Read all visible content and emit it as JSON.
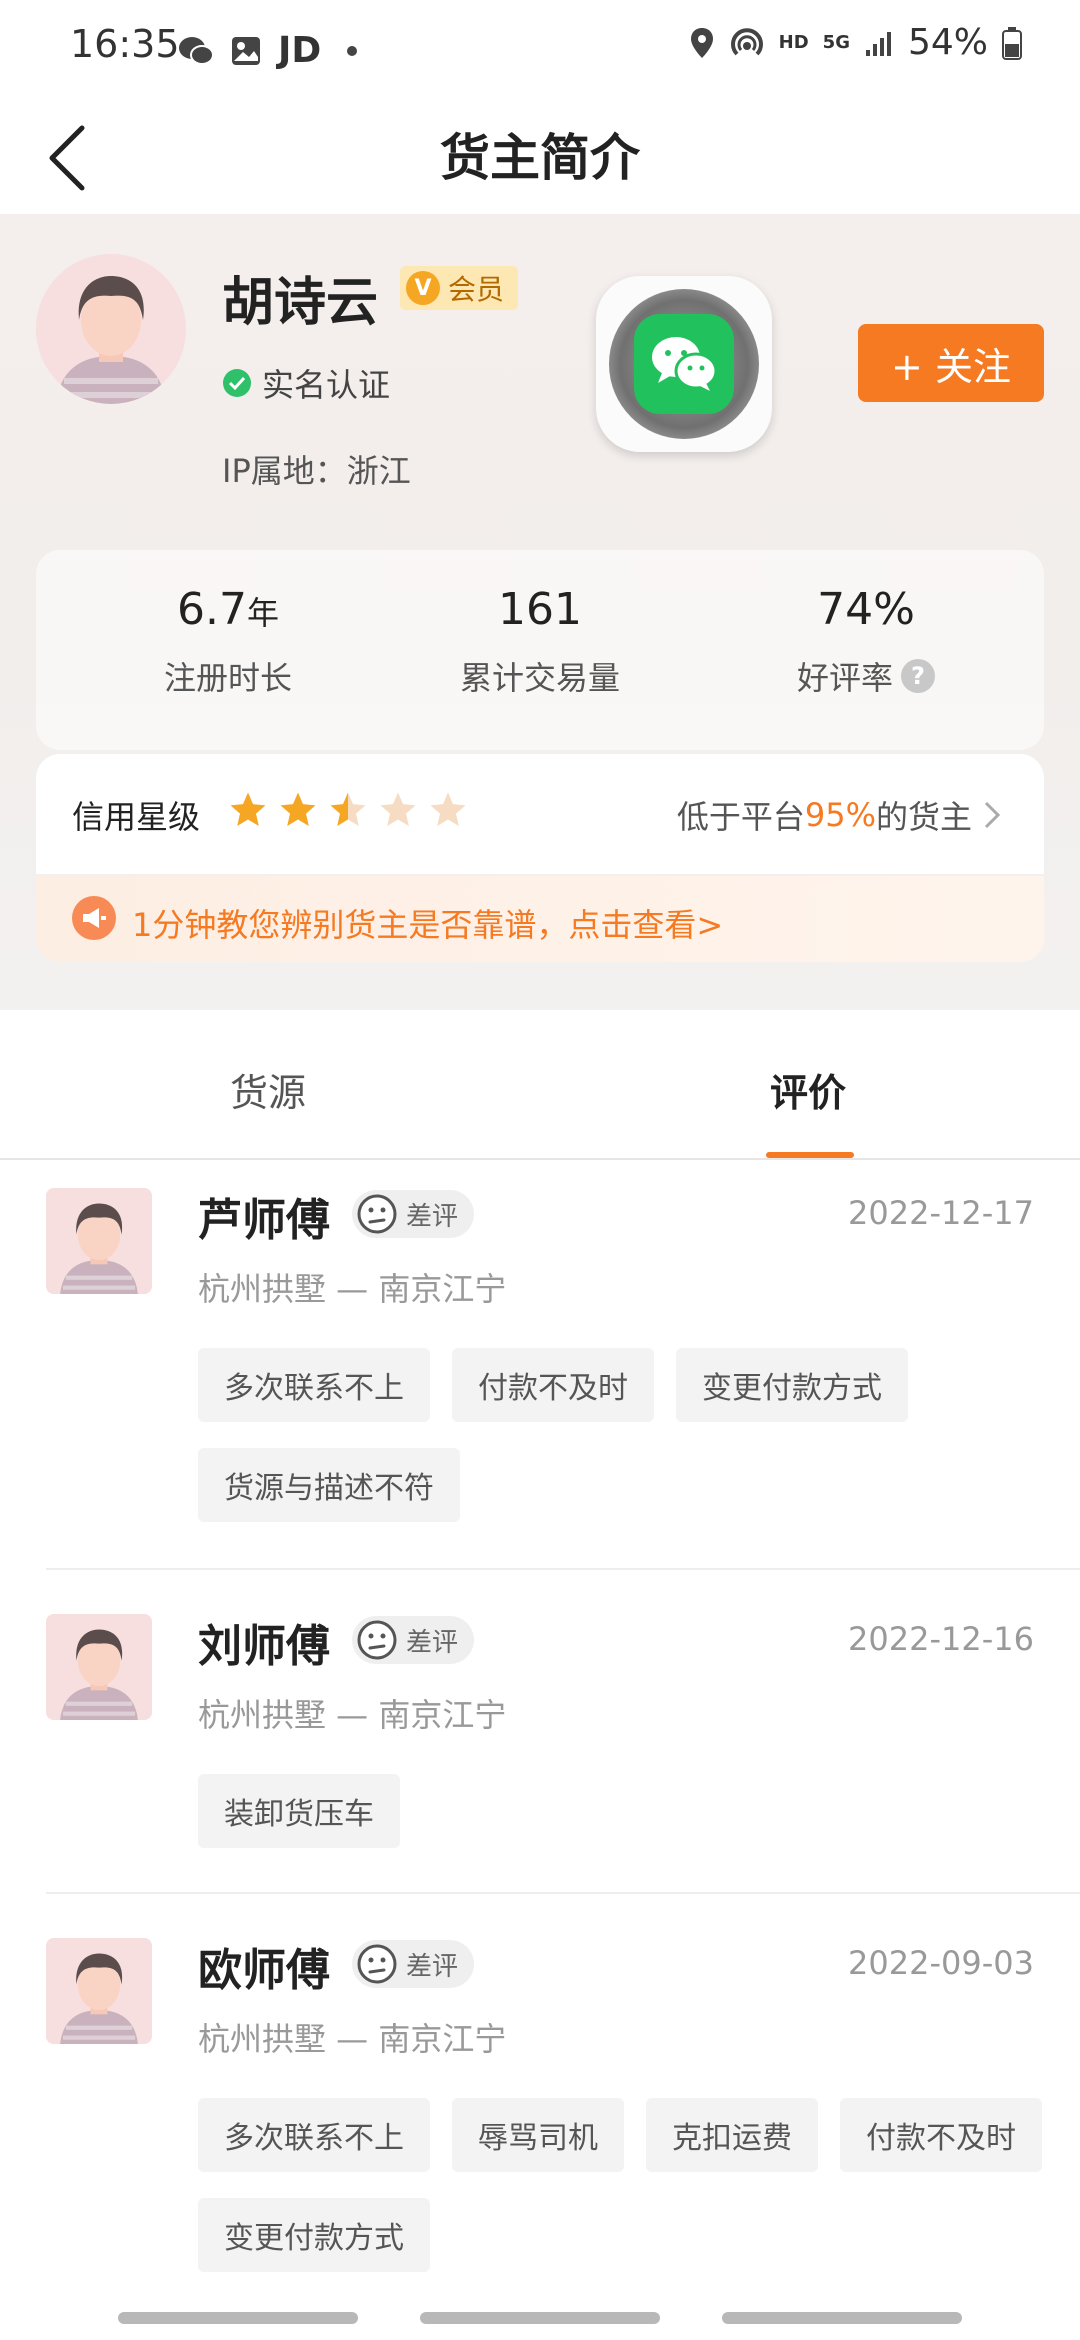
{
  "status_bar": {
    "time": "16:35",
    "app_label": "JD",
    "battery": "54%",
    "network": "5G",
    "hd": "HD"
  },
  "header": {
    "title": "货主简介"
  },
  "profile": {
    "name": "胡诗云",
    "vip_label": "会员",
    "vip_badge_letter": "V",
    "verified_label": "实名认证",
    "ip_label": "IP属地：浙江",
    "follow_label": "+ 关注"
  },
  "stats": [
    {
      "value": "6.7",
      "unit": "年",
      "label": "注册时长"
    },
    {
      "value": "161",
      "unit": "",
      "label": "累计交易量"
    },
    {
      "value": "74%",
      "unit": "",
      "label": "好评率"
    }
  ],
  "credit": {
    "label": "信用星级",
    "rating": 2.5,
    "max_stars": 5,
    "compare_prefix": "低于平台",
    "compare_value": "95%",
    "compare_suffix": "的货主"
  },
  "tip": {
    "text": "1分钟教您辨别货主是否靠谱，点击查看>"
  },
  "tabs": [
    {
      "label": "货源",
      "active": false
    },
    {
      "label": "评价",
      "active": true
    }
  ],
  "reviews": [
    {
      "name": "芦师傅",
      "badge": "差评",
      "date": "2022-12-17",
      "route": "杭州拱墅 — 南京江宁",
      "tags": [
        "多次联系不上",
        "付款不及时",
        "变更付款方式",
        "货源与描述不符"
      ]
    },
    {
      "name": "刘师傅",
      "badge": "差评",
      "date": "2022-12-16",
      "route": "杭州拱墅 — 南京江宁",
      "tags": [
        "装卸货压车"
      ]
    },
    {
      "name": "欧师傅",
      "badge": "差评",
      "date": "2022-09-03",
      "route": "杭州拱墅 — 南京江宁",
      "tags": [
        "多次联系不上",
        "辱骂司机",
        "克扣运费",
        "付款不及时",
        "变更付款方式"
      ]
    }
  ],
  "colors": {
    "accent": "#f57a22",
    "star": "#f5a623",
    "star_empty": "#f6dcc2",
    "wechat": "#21c25e"
  }
}
